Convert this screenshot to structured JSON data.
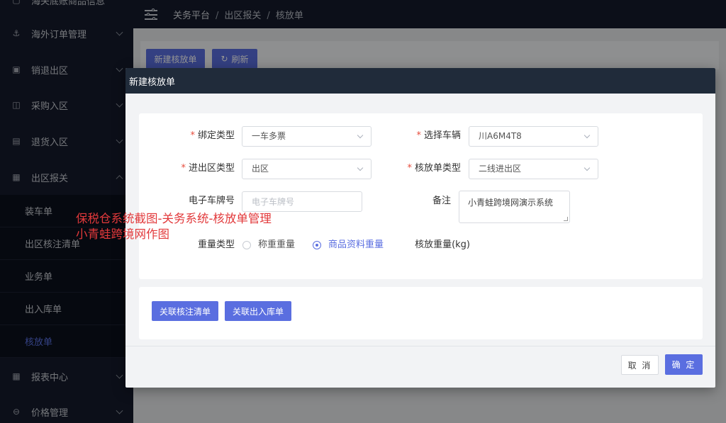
{
  "sidebar": {
    "items": [
      {
        "label": "海关底账商品信息",
        "icon": "box-icon"
      },
      {
        "label": "海外订单管理",
        "icon": "anchor-icon"
      },
      {
        "label": "销退出区",
        "icon": "return-icon"
      },
      {
        "label": "采购入区",
        "icon": "purchase-icon"
      },
      {
        "label": "退货入区",
        "icon": "refund-icon"
      },
      {
        "label": "出区报关",
        "icon": "document-icon"
      },
      {
        "label": "报表中心",
        "icon": "report-icon"
      },
      {
        "label": "价格管理",
        "icon": "price-icon"
      }
    ],
    "submenu": [
      {
        "label": "装车单"
      },
      {
        "label": "出区核注清单"
      },
      {
        "label": "业务单"
      },
      {
        "label": "出入库单"
      },
      {
        "label": "核放单"
      }
    ]
  },
  "header": {
    "breadcrumb": [
      "关务平台",
      "出区报关",
      "核放单"
    ],
    "separator": "/"
  },
  "toolbar": {
    "new_label": "新建核放单",
    "refresh_label": "刷新",
    "refresh_icon": "↻"
  },
  "dialog": {
    "title": "新建核放单",
    "form": {
      "bind_type": {
        "label": "绑定类型",
        "value": "一车多票"
      },
      "vehicle": {
        "label": "选择车辆",
        "value": "川A6M4T8"
      },
      "inout_type": {
        "label": "进出区类型",
        "value": "出区"
      },
      "release_type": {
        "label": "核放单类型",
        "value": "二线进出区"
      },
      "plate": {
        "label": "电子车牌号",
        "placeholder": "电子车牌号",
        "value": ""
      },
      "remark": {
        "label": "备注",
        "value": "小青蛙跨境网演示系统"
      },
      "weight_type": {
        "label": "重量类型",
        "options": [
          "称重重量",
          "商品资料重量"
        ],
        "selected": "商品资料重量"
      },
      "release_weight": {
        "label": "核放重量(kg)"
      }
    },
    "actions": {
      "link_declaration": "关联核注清单",
      "link_inout": "关联出入库单"
    },
    "footer": {
      "cancel": "取 消",
      "confirm": "确 定"
    }
  },
  "watermark": {
    "line1": "保税仓系统截图-关务系统-核放单管理",
    "line2": "小青蛙跨境网作图"
  },
  "colors": {
    "sidebar_bg": "#151b2c",
    "accent": "#5a6ee0",
    "required": "#e74c3c",
    "watermark": "#e2393b"
  }
}
